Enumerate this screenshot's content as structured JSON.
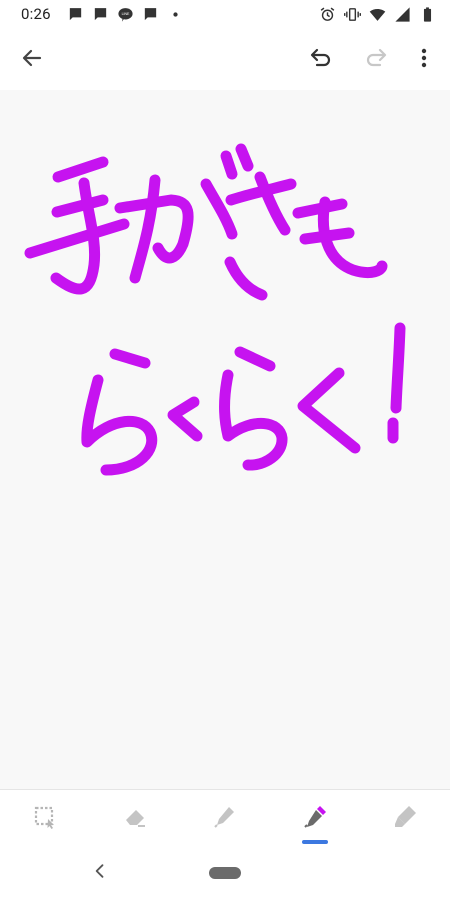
{
  "status_bar": {
    "time": "0:26",
    "notification_icons": [
      "message-icon",
      "message-icon",
      "line-icon",
      "message-icon",
      "dot-icon"
    ],
    "system_icons": [
      "alarm-icon",
      "vibrate-icon",
      "wifi-icon",
      "signal-icon",
      "battery-icon"
    ]
  },
  "app_bar": {
    "back_icon": "arrow-back-icon",
    "undo_icon": "undo-icon",
    "redo_icon": "redo-icon",
    "more_icon": "more-vert-icon"
  },
  "canvas": {
    "ink_color": "#c613f0",
    "background": "#f8f8f8"
  },
  "toolbar": {
    "tools": [
      {
        "id": "select",
        "icon": "lasso-select-icon",
        "selected": false
      },
      {
        "id": "eraser",
        "icon": "eraser-icon",
        "selected": false
      },
      {
        "id": "pen",
        "icon": "pen-icon",
        "selected": false
      },
      {
        "id": "marker",
        "icon": "marker-icon",
        "selected": true
      },
      {
        "id": "highlighter",
        "icon": "highlighter-icon",
        "selected": false
      }
    ],
    "indicator_color": "#3c78e0"
  },
  "nav_bar": {
    "back_icon": "nav-back-icon",
    "home_icon": "home-pill-icon"
  }
}
